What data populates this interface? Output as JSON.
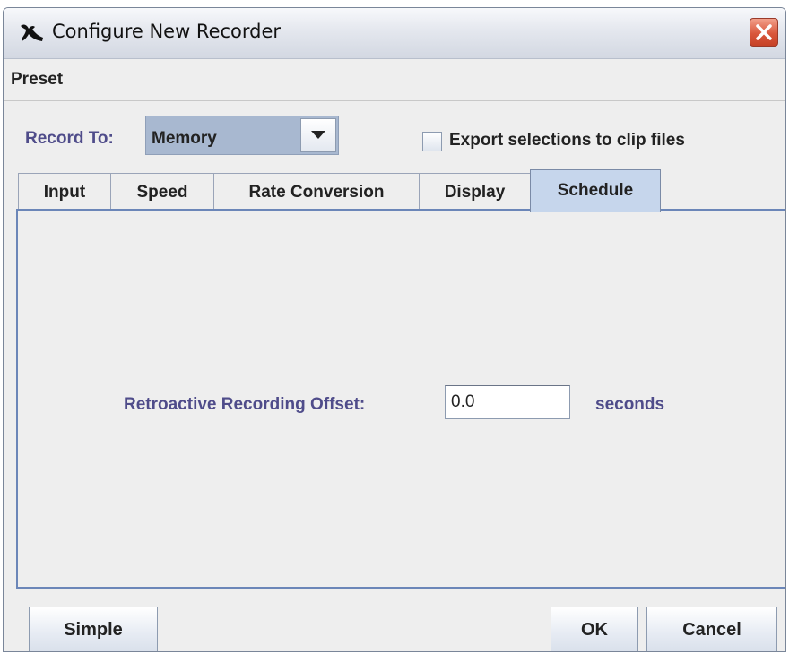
{
  "window": {
    "title": "Configure New Recorder",
    "app_icon": "bird-icon",
    "close_icon": "close-icon"
  },
  "menu": {
    "items": [
      "Preset"
    ]
  },
  "record_to": {
    "label": "Record To:",
    "value": "Memory",
    "export_checkbox": {
      "label": "Export selections to clip files",
      "checked": false
    }
  },
  "tabs": [
    {
      "label": "Input",
      "active": false
    },
    {
      "label": "Speed",
      "active": false
    },
    {
      "label": "Rate Conversion",
      "active": false
    },
    {
      "label": "Display",
      "active": false
    },
    {
      "label": "Schedule",
      "active": true
    }
  ],
  "schedule": {
    "offset_label": "Retroactive Recording Offset:",
    "offset_value": "0.0",
    "unit": "seconds"
  },
  "buttons": {
    "simple": "Simple",
    "ok": "OK",
    "cancel": "Cancel"
  },
  "colors": {
    "label_text": "#4f4c8a",
    "active_tab": "#c6d6ec",
    "combo_bg": "#a8b8d0",
    "close_button": "#d9573c"
  }
}
